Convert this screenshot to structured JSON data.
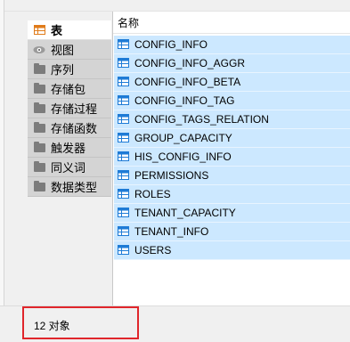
{
  "sidebar": {
    "items": [
      {
        "label": "表",
        "icon": "table-icon",
        "selected": true
      },
      {
        "label": "视图",
        "icon": "view-icon",
        "selected": false
      },
      {
        "label": "序列",
        "icon": "folder-icon",
        "selected": false
      },
      {
        "label": "存储包",
        "icon": "folder-icon",
        "selected": false
      },
      {
        "label": "存储过程",
        "icon": "folder-icon",
        "selected": false
      },
      {
        "label": "存储函数",
        "icon": "folder-icon",
        "selected": false
      },
      {
        "label": "触发器",
        "icon": "folder-icon",
        "selected": false
      },
      {
        "label": "同义词",
        "icon": "folder-icon",
        "selected": false
      },
      {
        "label": "数据类型",
        "icon": "folder-icon",
        "selected": false
      }
    ]
  },
  "objects": {
    "column_header": "名称",
    "rows": [
      "CONFIG_INFO",
      "CONFIG_INFO_AGGR",
      "CONFIG_INFO_BETA",
      "CONFIG_INFO_TAG",
      "CONFIG_TAGS_RELATION",
      "GROUP_CAPACITY",
      "HIS_CONFIG_INFO",
      "PERMISSIONS",
      "ROLES",
      "TENANT_CAPACITY",
      "TENANT_INFO",
      "USERS"
    ]
  },
  "status": {
    "count_text": "12 对象"
  },
  "colors": {
    "selection": "#cce8ff",
    "table_icon": "#1e7bd6",
    "sidebar_table_icon": "#e07b1a",
    "highlight": "#e0262b"
  }
}
